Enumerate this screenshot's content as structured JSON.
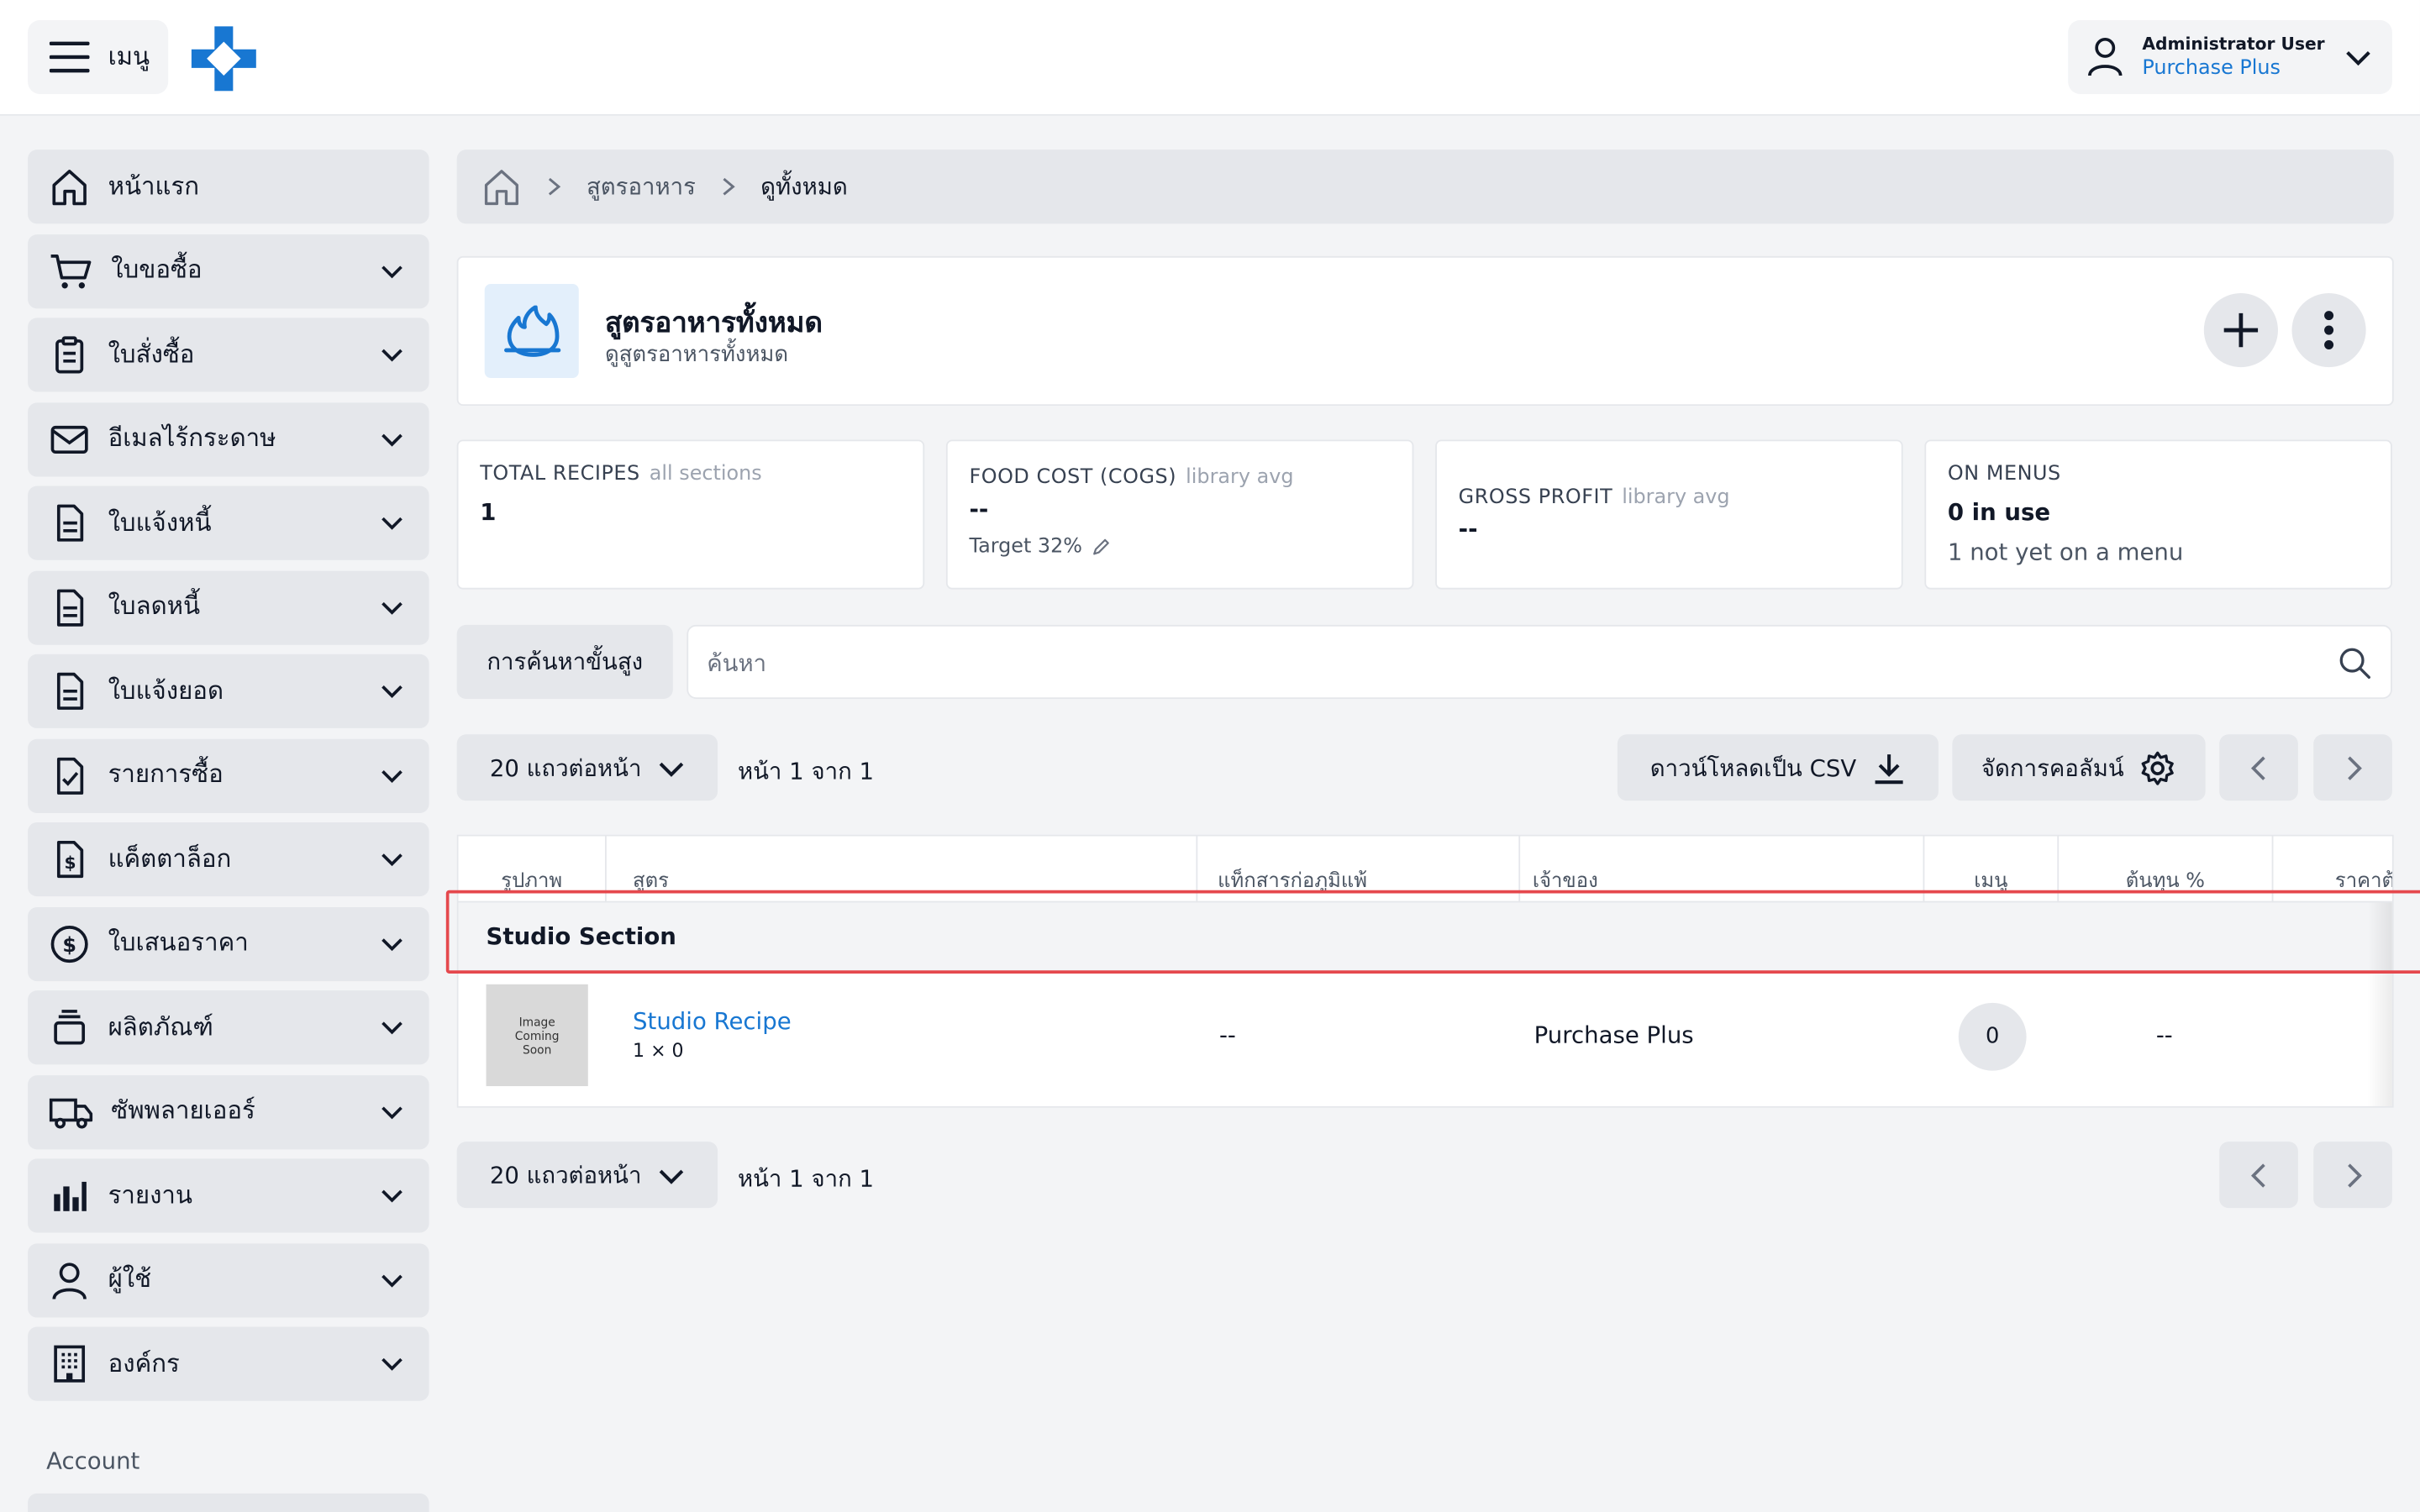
{
  "topbar": {
    "menu_label": "เมนู",
    "user_name": "Administrator User",
    "user_org": "Purchase Plus"
  },
  "sidebar": {
    "items": [
      {
        "label": "หน้าแรก",
        "icon": "home-icon",
        "expandable": false
      },
      {
        "label": "ใบขอซื้อ",
        "icon": "cart-icon",
        "expandable": true
      },
      {
        "label": "ใบสั่งซื้อ",
        "icon": "clipboard-icon",
        "expandable": true
      },
      {
        "label": "อีเมลไร้กระดาษ",
        "icon": "mail-icon",
        "expandable": true
      },
      {
        "label": "ใบแจ้งหนี้",
        "icon": "document-icon",
        "expandable": true
      },
      {
        "label": "ใบลดหนี้",
        "icon": "document-icon",
        "expandable": true
      },
      {
        "label": "ใบแจ้งยอด",
        "icon": "document-icon",
        "expandable": true
      },
      {
        "label": "รายการซื้อ",
        "icon": "checklist-icon",
        "expandable": true
      },
      {
        "label": "แค็ตตาล็อก",
        "icon": "price-doc-icon",
        "expandable": true
      },
      {
        "label": "ใบเสนอราคา",
        "icon": "dollar-circle-icon",
        "expandable": true
      },
      {
        "label": "ผลิตภัณฑ์",
        "icon": "stack-icon",
        "expandable": true
      },
      {
        "label": "ซัพพลายเออร์",
        "icon": "truck-icon",
        "expandable": true
      },
      {
        "label": "รายงาน",
        "icon": "bar-chart-icon",
        "expandable": true
      },
      {
        "label": "ผู้ใช้",
        "icon": "user-icon",
        "expandable": true
      },
      {
        "label": "องค์กร",
        "icon": "building-icon",
        "expandable": true
      }
    ],
    "account_label": "Account"
  },
  "breadcrumb": {
    "items": [
      "สูตรอาหาร",
      "ดูทั้งหมด"
    ]
  },
  "header": {
    "title": "สูตรอาหารทั้งหมด",
    "subtitle": "ดูสูตรอาหารทั้งหมด"
  },
  "stats": {
    "total_recipes": {
      "label": "TOTAL RECIPES",
      "muted": "all sections",
      "value": "1"
    },
    "food_cost": {
      "label": "FOOD COST (COGS)",
      "muted": "library avg",
      "value": "--",
      "note": "Target 32%"
    },
    "gross_profit": {
      "label": "GROSS PROFIT",
      "muted": "library avg",
      "value": "--"
    },
    "on_menus": {
      "label": "ON MENUS",
      "value": "0 in use",
      "note": "1 not yet on a menu"
    }
  },
  "search": {
    "advanced_label": "การค้นหาขั้นสูง",
    "placeholder": "ค้นหา",
    "value": ""
  },
  "toolbar": {
    "rows_per_page": "20 แถวต่อหน้า",
    "page_info": "หน้า 1 จาก 1",
    "download_csv": "ดาวน์โหลดเป็น CSV",
    "manage_columns": "จัดการคอลัมน์"
  },
  "table": {
    "columns": [
      "รูปภาพ",
      "สูตร",
      "แท็กสารก่อภูมิแพ้",
      "เจ้าของ",
      "เมนู",
      "ต้นทุน %",
      "ราคาต้"
    ],
    "section_name": "Studio Section",
    "rows": [
      {
        "image_text": "Image Coming Soon",
        "name": "Studio Recipe",
        "meta": "1 × 0",
        "allergens": "--",
        "owner": "Purchase Plus",
        "menus": "0",
        "cost_percent": "--"
      }
    ]
  },
  "colors": {
    "accent": "#1877d2",
    "highlight": "#e5484d",
    "panel": "#e5e7eb"
  }
}
